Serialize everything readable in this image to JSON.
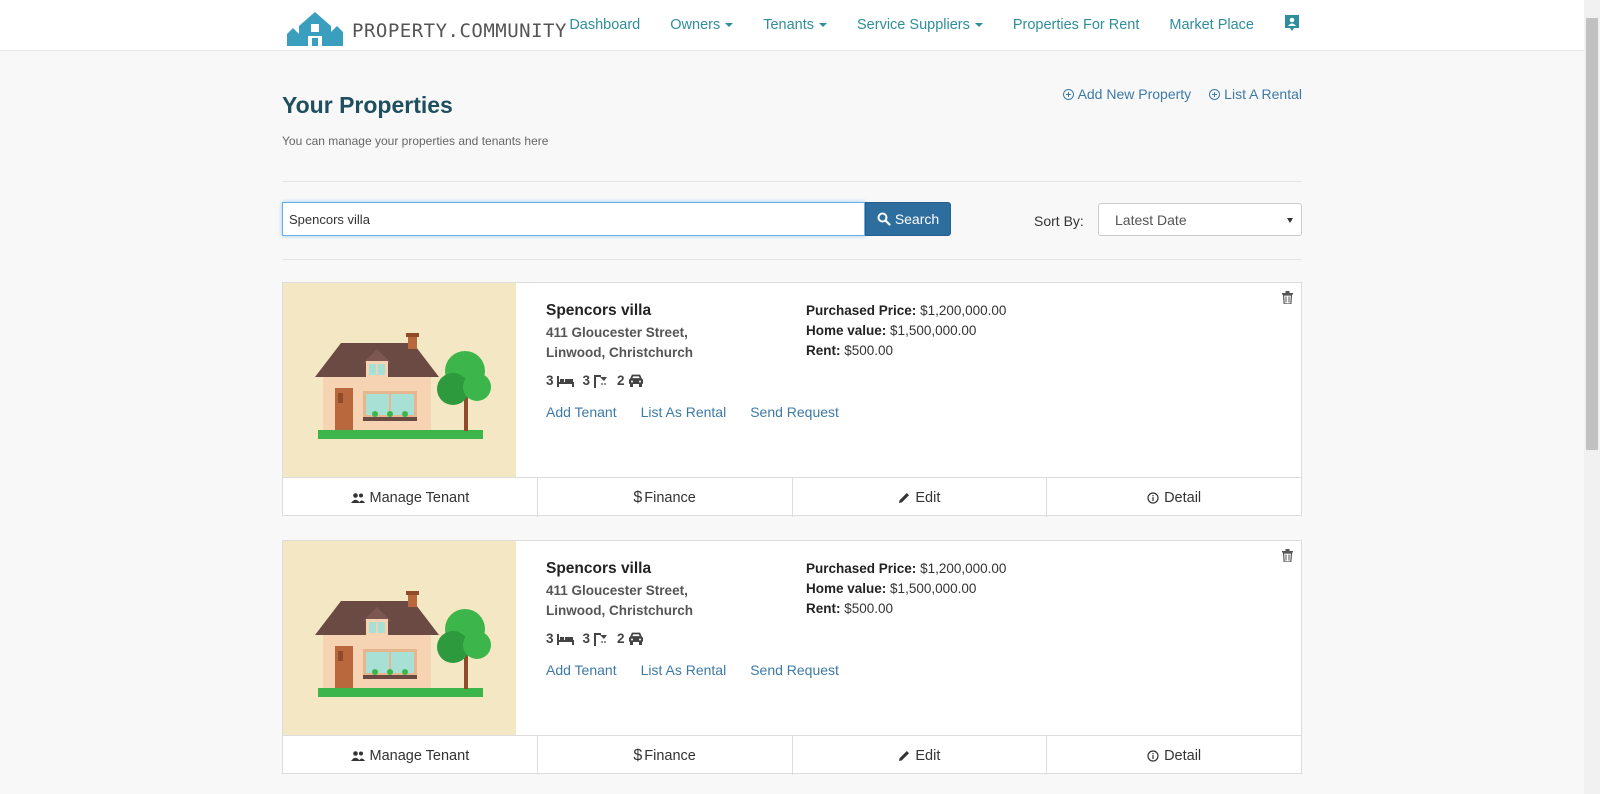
{
  "brand": {
    "name": "PROPERTY.COMMUNITY"
  },
  "nav": {
    "items": [
      {
        "label": "Dashboard",
        "dropdown": false
      },
      {
        "label": "Owners",
        "dropdown": true
      },
      {
        "label": "Tenants",
        "dropdown": true
      },
      {
        "label": "Service Suppliers",
        "dropdown": true
      },
      {
        "label": "Properties For Rent",
        "dropdown": false
      },
      {
        "label": "Market Place",
        "dropdown": false
      }
    ],
    "profile_icon": "contact-card-icon"
  },
  "header": {
    "title": "Your Properties",
    "subtitle": "You can manage your properties and tenants here",
    "add_property_label": "Add New Property",
    "list_rental_label": "List A Rental"
  },
  "search": {
    "value": "Spencors villa",
    "button_label": "Search"
  },
  "sort": {
    "label": "Sort By:",
    "selected": "Latest Date"
  },
  "properties": [
    {
      "name": "Spencors villa",
      "address_line1": "411 Gloucester Street,",
      "address_line2": "Linwood, Christchurch",
      "bedrooms": "3",
      "bathrooms": "3",
      "parking": "2",
      "purchased_price_label": "Purchased Price:",
      "purchased_price": "$1,200,000.00",
      "home_value_label": "Home value:",
      "home_value": "$1,500,000.00",
      "rent_label": "Rent:",
      "rent": "$500.00",
      "actions": {
        "add_tenant": "Add Tenant",
        "list_as_rental": "List As Rental",
        "send_request": "Send Request"
      },
      "footer": {
        "manage_tenant": "Manage Tenant",
        "finance": "Finance",
        "edit": "Edit",
        "detail": "Detail"
      }
    },
    {
      "name": "Spencors villa",
      "address_line1": "411 Gloucester Street,",
      "address_line2": "Linwood, Christchurch",
      "bedrooms": "3",
      "bathrooms": "3",
      "parking": "2",
      "purchased_price_label": "Purchased Price:",
      "purchased_price": "$1,200,000.00",
      "home_value_label": "Home value:",
      "home_value": "$1,500,000.00",
      "rent_label": "Rent:",
      "rent": "$500.00",
      "actions": {
        "add_tenant": "Add Tenant",
        "list_as_rental": "List As Rental",
        "send_request": "Send Request"
      },
      "footer": {
        "manage_tenant": "Manage Tenant",
        "finance": "Finance",
        "edit": "Edit",
        "detail": "Detail"
      }
    }
  ],
  "colors": {
    "brand": "#2f8e9b",
    "link": "#3d7aa8",
    "search_button": "#2e6e9e",
    "image_bg": "#f3e7c4"
  }
}
